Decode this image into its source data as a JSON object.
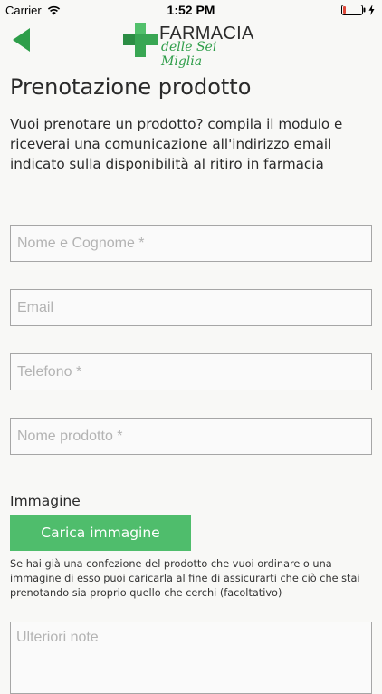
{
  "status_bar": {
    "carrier": "Carrier",
    "time": "1:52 PM",
    "icons": [
      "wifi-icon",
      "battery-low-icon",
      "charging-bolt-icon"
    ]
  },
  "nav": {
    "back_icon": "back-arrow-icon",
    "logo": {
      "icon": "green-cross-icon",
      "title": "FARMACIA",
      "subtitle": "delle Sei Miglia"
    }
  },
  "page": {
    "title": "Prenotazione prodotto",
    "intro": "Vuoi prenotare un prodotto? compila il modulo e riceverai una comunicazione all'indirizzo email indicato sulla disponibilità al ritiro in farmacia"
  },
  "form": {
    "name_placeholder": "Nome e Cognome *",
    "email_placeholder": "Email",
    "phone_placeholder": "Telefono *",
    "product_placeholder": "Nome prodotto *",
    "image_section_label": "Immagine",
    "upload_button_label": "Carica immagine",
    "upload_help": "Se hai già una confezione del prodotto che vuoi ordinare o una immagine di esso puoi caricarla al fine di assicurarti che ciò che stai prenotando sia proprio quello che cerchi (facoltativo)",
    "notes_placeholder": "Ulteriori note"
  },
  "colors": {
    "accent_green": "#4fbd6c",
    "logo_green": "#2f9e4a",
    "battery_low": "#e0493a",
    "background": "#f8f8f6"
  }
}
